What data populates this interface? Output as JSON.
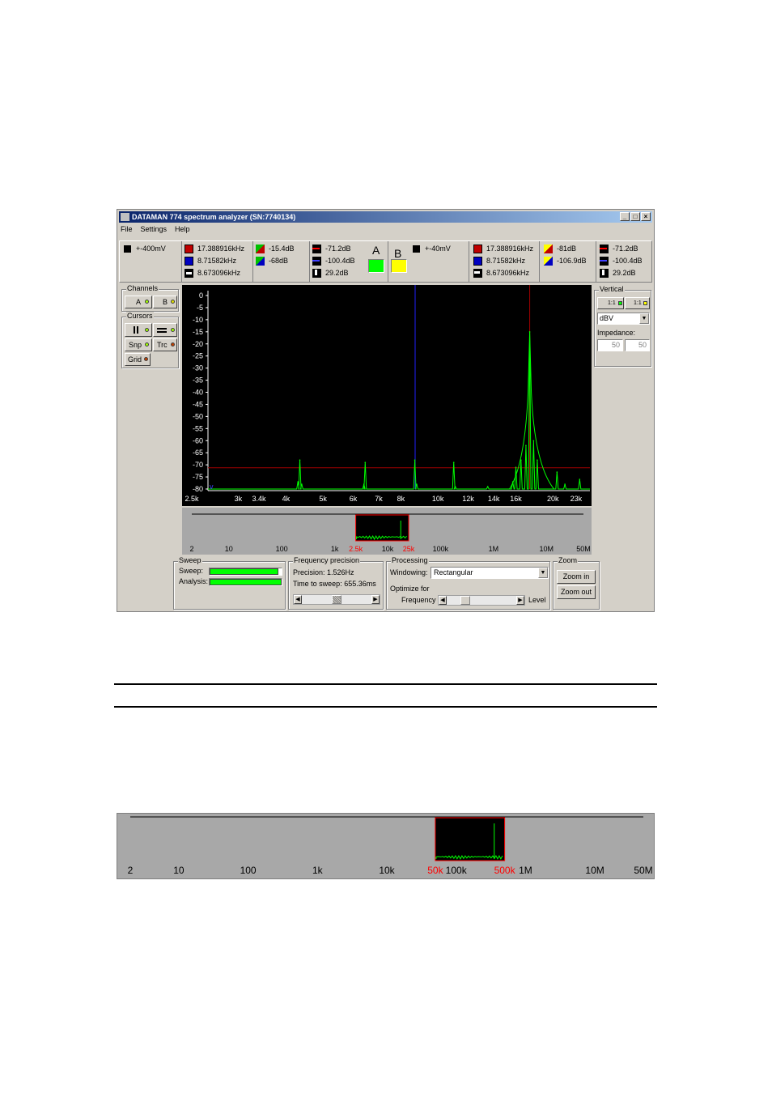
{
  "window": {
    "title": "DATAMAN 774 spectrum analyzer (SN:7740134)",
    "controls": {
      "minimize": "_",
      "maximize": "□",
      "close": "×"
    }
  },
  "menu": [
    "File",
    "Settings",
    "Help"
  ],
  "readout_a": {
    "range": "+-400mV",
    "freqs": [
      "17.388916kHz",
      "8.71582kHz",
      "8.673096kHz"
    ],
    "ratios": [
      "-15.4dB",
      "-68dB"
    ],
    "levels": [
      "-71.2dB",
      "-100.4dB",
      "29.2dB"
    ],
    "label": "A",
    "color": "#00ff00"
  },
  "readout_b": {
    "range": "+-40mV",
    "freqs": [
      "17.388916kHz",
      "8.71582kHz",
      "8.673096kHz"
    ],
    "ratios": [
      "-81dB",
      "-106.9dB"
    ],
    "levels": [
      "-71.2dB",
      "-100.4dB",
      "29.2dB"
    ],
    "label": "B",
    "color": "#ffff00"
  },
  "left_panel": {
    "channels_title": "Channels",
    "channel_a": "A",
    "channel_b": "B",
    "cursors_title": "Cursors",
    "snp": "Snp",
    "trc": "Trc",
    "grid": "Grid"
  },
  "right_panel": {
    "vertical_title": "Vertical",
    "ch1": "1:1",
    "ch2": "1:1",
    "unit": "dBV",
    "impedance_label": "Impedance:",
    "imp_a": "50",
    "imp_b": "50"
  },
  "bottom": {
    "sweep_title": "Sweep",
    "sweep_label": "Sweep:",
    "analysis_label": "Analysis:",
    "sweep_progress": 0.96,
    "analysis_progress": 1.0,
    "freqprec_title": "Frequency precision",
    "precision": "Precision: 1.526Hz",
    "time_to_sweep": "Time to sweep: 655.36ms",
    "processing_title": "Processing",
    "windowing_label": "Windowing:",
    "windowing_value": "Rectangular",
    "optimize_label": "Optimize for",
    "freq_label": "Frequency",
    "level_label": "Level",
    "zoom_title": "Zoom",
    "zoom_in": "Zoom in",
    "zoom_out": "Zoom out"
  },
  "overview": {
    "ticks": [
      "2",
      "10",
      "100",
      "1k",
      "10k",
      "100k",
      "1M",
      "10M",
      "50M"
    ],
    "markers": [
      "2.5k",
      "25k"
    ],
    "marker_color": "#ff0000"
  },
  "overview2": {
    "ticks": [
      "2",
      "10",
      "100",
      "1k",
      "10k",
      "100k",
      "1M",
      "10M",
      "50M"
    ],
    "markers": [
      "50k",
      "500k"
    ],
    "marker_color": "#ff0000"
  },
  "chart_data": {
    "type": "line",
    "xscale": "log",
    "x_tick_labels": [
      "2.5k",
      "3k",
      "3.4k",
      "4k",
      "5k",
      "6k",
      "7k",
      "8k",
      "10k",
      "12k",
      "14k",
      "16k",
      "20k",
      "23k"
    ],
    "y_tick_labels": [
      "0",
      "-5",
      "-10",
      "-15",
      "-20",
      "-25",
      "-30",
      "-35",
      "-40",
      "-45",
      "-50",
      "-55",
      "-60",
      "-65",
      "-70",
      "-75",
      "-80"
    ],
    "ylim": [
      -80,
      0
    ],
    "xlim": [
      2500,
      25000
    ],
    "series": [
      {
        "color": "#00ff00",
        "x": [
          4300,
          4350,
          4400,
          6400,
          6450,
          8700,
          8800,
          11000,
          11100,
          13500,
          15700,
          16000,
          16500,
          17000,
          17389,
          17800,
          18200,
          20500,
          21500,
          23500
        ],
        "values": [
          -77,
          -68,
          -78,
          -78,
          -69,
          -68,
          -78,
          -69,
          -79,
          -79,
          -77,
          -71,
          -68,
          -62,
          -15,
          -60,
          -68,
          -73,
          -78,
          -76
        ]
      }
    ],
    "cursor_h_db": -71.2,
    "cursor_v_blue_khz": 8.71582,
    "cursor_v_red_khz": 17.388916
  }
}
